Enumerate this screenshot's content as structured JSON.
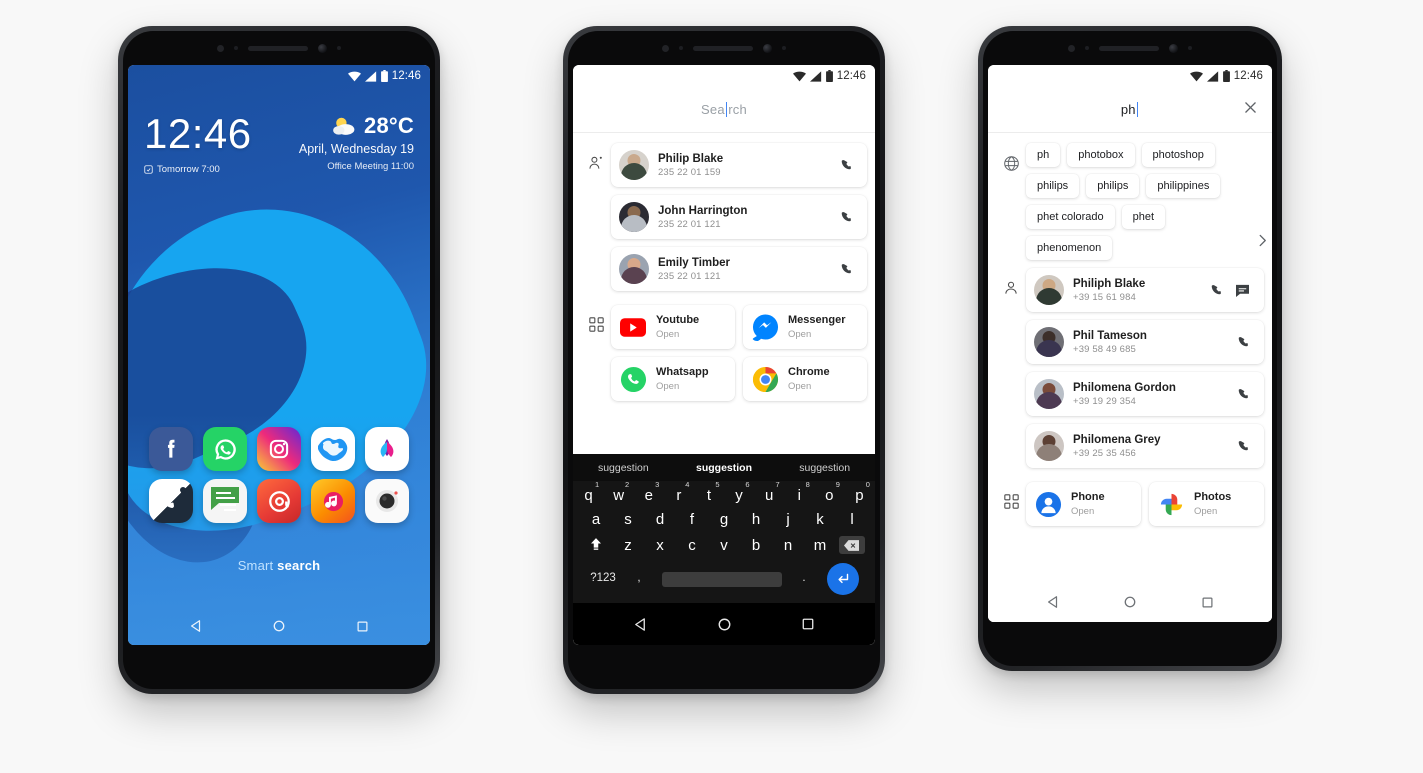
{
  "scene": {
    "title": "Smart Search Android concept — three phone mockups",
    "background_color": "#f8f8f8"
  },
  "phone1": {
    "name": "home-screen-phone",
    "statusbar": {
      "time": "12:46",
      "wifi": "wifi-icon",
      "signal": "signal-icon",
      "battery": "battery-icon"
    },
    "clock": {
      "time": "12:46",
      "alarm_icon": "alarm-icon",
      "alarm": "Tomorrow 7:00"
    },
    "weather": {
      "icon": "sun-cloud-icon",
      "temperature": "28°C",
      "date": "April, Wednesday 19",
      "event": "Office Meeting 11:00"
    },
    "apps": [
      {
        "name": "Facebook",
        "icon": "facebook-icon",
        "color": "#3b5998"
      },
      {
        "name": "WhatsApp",
        "icon": "whatsapp-icon",
        "color": "#25d366"
      },
      {
        "name": "Instagram",
        "icon": "instagram-icon",
        "color": "#e1306c"
      },
      {
        "name": "Maps",
        "icon": "globe-map-icon",
        "color": "#ffffff"
      },
      {
        "name": "Gallery",
        "icon": "lotus-icon",
        "color": "#ffffff"
      },
      {
        "name": "Phone",
        "icon": "phone-icon",
        "color": "#ffffff"
      },
      {
        "name": "Messages",
        "icon": "message-icon",
        "color": "#ffffff"
      },
      {
        "name": "Email",
        "icon": "at-sign-icon",
        "color": "#f2452c"
      },
      {
        "name": "Music",
        "icon": "music-note-icon",
        "color": "#f9a825"
      },
      {
        "name": "Camera",
        "icon": "camera-icon",
        "color": "#ffffff"
      }
    ],
    "smart_search": {
      "word1": "Smart",
      "word2": "search"
    },
    "nav": {
      "back": "back-icon",
      "home": "home-icon",
      "recents": "recents-icon"
    }
  },
  "phone2": {
    "name": "search-open-phone",
    "statusbar": {
      "time": "12:46"
    },
    "search": {
      "placeholder": "Search",
      "value": ""
    },
    "contacts_section": {
      "icon": "person-add-icon",
      "items": [
        {
          "name": "Philip Blake",
          "number": "235 22 01 159",
          "action": "call-icon"
        },
        {
          "name": "John Harrington",
          "number": "235 22 01 121",
          "action": "call-icon"
        },
        {
          "name": "Emily Timber",
          "number": "235 22 01 121",
          "action": "call-icon"
        }
      ]
    },
    "apps_section": {
      "icon": "apps-grid-icon",
      "items": [
        {
          "name": "Youtube",
          "subtitle": "Open",
          "icon": "youtube-icon"
        },
        {
          "name": "Messenger",
          "subtitle": "Open",
          "icon": "messenger-icon"
        },
        {
          "name": "Whatsapp",
          "subtitle": "Open",
          "icon": "whatsapp-icon"
        },
        {
          "name": "Chrome",
          "subtitle": "Open",
          "icon": "chrome-icon"
        }
      ]
    },
    "keyboard": {
      "suggestions": [
        "suggestion",
        "suggestion",
        "suggestion"
      ],
      "active_suggestion_index": 1,
      "row1": [
        {
          "k": "q",
          "n": "1"
        },
        {
          "k": "w",
          "n": "2"
        },
        {
          "k": "e",
          "n": "3"
        },
        {
          "k": "r",
          "n": "4"
        },
        {
          "k": "t",
          "n": "5"
        },
        {
          "k": "y",
          "n": "6"
        },
        {
          "k": "u",
          "n": "7"
        },
        {
          "k": "i",
          "n": "8"
        },
        {
          "k": "o",
          "n": "9"
        },
        {
          "k": "p",
          "n": "0"
        }
      ],
      "row2": [
        "a",
        "s",
        "d",
        "f",
        "g",
        "h",
        "j",
        "k",
        "l"
      ],
      "row3": [
        "z",
        "x",
        "c",
        "v",
        "b",
        "n",
        "m"
      ],
      "shift_icon": "shift-icon",
      "backspace_icon": "backspace-icon",
      "symbols_key": "?123",
      "comma_key": ",",
      "period_key": ".",
      "enter_icon": "enter-icon"
    },
    "nav": {
      "back": "back-icon",
      "home": "home-icon",
      "recents": "recents-icon"
    }
  },
  "phone3": {
    "name": "search-results-phone",
    "statusbar": {
      "time": "12:46"
    },
    "search": {
      "value": "ph",
      "clear_icon": "close-icon"
    },
    "web_section": {
      "icon": "web-globe-icon",
      "more_icon": "chevron-right-icon",
      "suggestions": [
        "ph",
        "photobox",
        "photoshop",
        "philips",
        "philips",
        "philippines",
        "phet colorado",
        "phet",
        "phenomenon"
      ]
    },
    "contacts_section": {
      "icon": "person-icon",
      "items": [
        {
          "name": "Philiph Blake",
          "number": "+39 15 61 984",
          "actions": [
            "call-icon",
            "message-icon"
          ]
        },
        {
          "name": "Phil Tameson",
          "number": "+39 58 49 685",
          "actions": [
            "call-icon"
          ]
        },
        {
          "name": "Philomena Gordon",
          "number": "+39 19 29 354",
          "actions": [
            "call-icon"
          ]
        },
        {
          "name": "Philomena Grey",
          "number": "+39 25 35 456",
          "actions": [
            "call-icon"
          ]
        }
      ]
    },
    "apps_section": {
      "icon": "apps-grid-icon",
      "items": [
        {
          "name": "Phone",
          "subtitle": "Open",
          "icon": "phone-contacts-icon"
        },
        {
          "name": "Photos",
          "subtitle": "Open",
          "icon": "google-photos-icon"
        }
      ]
    },
    "nav": {
      "back": "back-icon",
      "home": "home-icon",
      "recents": "recents-icon"
    }
  }
}
